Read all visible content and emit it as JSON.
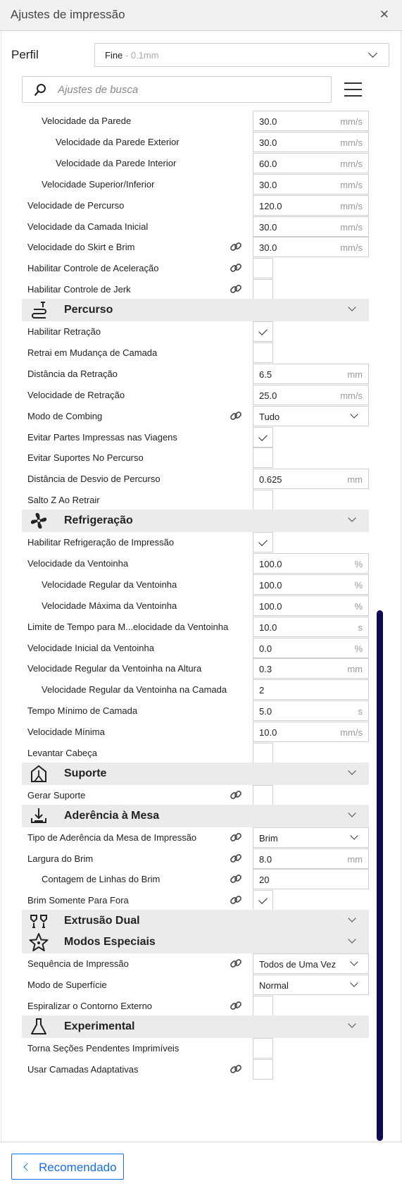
{
  "window": {
    "title": "Ajustes de impressão"
  },
  "profile": {
    "label": "Perfil",
    "name": "Fine",
    "detail": " - 0.1mm"
  },
  "search": {
    "placeholder": "Ajustes de busca"
  },
  "rows": [
    {
      "label": "Velocidade da Parede",
      "indent": 1,
      "control": "field",
      "value": "30.0",
      "unit": "mm/s",
      "link": false
    },
    {
      "label": "Velocidade da Parede Exterior",
      "indent": 2,
      "control": "field",
      "value": "30.0",
      "unit": "mm/s",
      "link": false
    },
    {
      "label": "Velocidade da Parede Interior",
      "indent": 2,
      "control": "field",
      "value": "60.0",
      "unit": "mm/s",
      "link": false
    },
    {
      "label": "Velocidade Superior/Inferior",
      "indent": 1,
      "control": "field",
      "value": "30.0",
      "unit": "mm/s",
      "link": false
    },
    {
      "label": "Velocidade de Percurso",
      "indent": 0,
      "control": "field",
      "value": "120.0",
      "unit": "mm/s",
      "link": false
    },
    {
      "label": "Velocidade da Camada Inicial",
      "indent": 0,
      "control": "field",
      "value": "30.0",
      "unit": "mm/s",
      "link": false
    },
    {
      "label": "Velocidade do Skirt e Brim",
      "indent": 0,
      "control": "field",
      "value": "30.0",
      "unit": "mm/s",
      "link": true
    },
    {
      "label": "Habilitar Controle de Aceleração",
      "indent": 0,
      "control": "checkbox",
      "checked": false,
      "link": true
    },
    {
      "label": "Habilitar Controle de Jerk",
      "indent": 0,
      "control": "checkbox",
      "checked": false,
      "link": true
    },
    {
      "category": "Percurso",
      "icon": "travel-icon"
    },
    {
      "label": "Habilitar Retração",
      "indent": 0,
      "control": "checkbox",
      "checked": true,
      "link": false
    },
    {
      "label": "Retrai em Mudança de Camada",
      "indent": 0,
      "control": "checkbox",
      "checked": false,
      "link": false
    },
    {
      "label": "Distância da Retração",
      "indent": 0,
      "control": "field",
      "value": "6.5",
      "unit": "mm",
      "link": false
    },
    {
      "label": "Velocidade de Retração",
      "indent": 0,
      "control": "field",
      "value": "25.0",
      "unit": "mm/s",
      "link": false
    },
    {
      "label": "Modo de Combing",
      "indent": 0,
      "control": "dropdown",
      "value": "Tudo",
      "link": true
    },
    {
      "label": "Evitar Partes Impressas nas Viagens",
      "indent": 0,
      "control": "checkbox",
      "checked": true,
      "link": false
    },
    {
      "label": "Evitar Suportes No Percurso",
      "indent": 0,
      "control": "checkbox",
      "checked": false,
      "link": false
    },
    {
      "label": "Distância de Desvio de Percurso",
      "indent": 0,
      "control": "field",
      "value": "0.625",
      "unit": "mm",
      "link": false
    },
    {
      "label": "Salto Z Ao Retrair",
      "indent": 0,
      "control": "checkbox",
      "checked": false,
      "link": false
    },
    {
      "category": "Refrigeração",
      "icon": "fan-icon"
    },
    {
      "label": "Habilitar Refrigeração de Impressão",
      "indent": 0,
      "control": "checkbox",
      "checked": true,
      "link": false
    },
    {
      "label": "Velocidade da Ventoinha",
      "indent": 0,
      "control": "field",
      "value": "100.0",
      "unit": "%",
      "link": false
    },
    {
      "label": "Velocidade Regular da Ventoinha",
      "indent": 1,
      "control": "field",
      "value": "100.0",
      "unit": "%",
      "link": false
    },
    {
      "label": "Velocidade Máxima da Ventoinha",
      "indent": 1,
      "control": "field",
      "value": "100.0",
      "unit": "%",
      "link": false
    },
    {
      "label": "Limite de Tempo para M...elocidade da Ventoinha",
      "indent": 0,
      "control": "field",
      "value": "10.0",
      "unit": "s",
      "link": false
    },
    {
      "label": "Velocidade Inicial da Ventoinha",
      "indent": 0,
      "control": "field",
      "value": "0.0",
      "unit": "%",
      "link": false
    },
    {
      "label": "Velocidade Regular da Ventoinha na Altura",
      "indent": 0,
      "control": "field",
      "value": "0.3",
      "unit": "mm",
      "link": false
    },
    {
      "label": "Velocidade Regular da Ventoinha na Camada",
      "indent": 1,
      "control": "field",
      "value": "2",
      "unit": "",
      "link": false
    },
    {
      "label": "Tempo Mínimo de Camada",
      "indent": 0,
      "control": "field",
      "value": "5.0",
      "unit": "s",
      "link": false
    },
    {
      "label": "Velocidade Mínima",
      "indent": 0,
      "control": "field",
      "value": "10.0",
      "unit": "mm/s",
      "link": false
    },
    {
      "label": "Levantar Cabeça",
      "indent": 0,
      "control": "checkbox",
      "checked": false,
      "link": false
    },
    {
      "category": "Suporte",
      "icon": "support-icon"
    },
    {
      "label": "Gerar Suporte",
      "indent": 0,
      "control": "checkbox",
      "checked": false,
      "link": true
    },
    {
      "category": "Aderência à Mesa",
      "icon": "adhesion-icon"
    },
    {
      "label": "Tipo de Aderência da Mesa de Impressão",
      "indent": 0,
      "control": "dropdown",
      "value": "Brim",
      "link": true
    },
    {
      "label": "Largura do Brim",
      "indent": 0,
      "control": "field",
      "value": "8.0",
      "unit": "mm",
      "link": true
    },
    {
      "label": "Contagem de Linhas do Brim",
      "indent": 1,
      "control": "field",
      "value": "20",
      "unit": "",
      "link": true
    },
    {
      "label": "Brim Somente Para Fora",
      "indent": 0,
      "control": "checkbox",
      "checked": true,
      "link": true
    },
    {
      "category": "Extrusão Dual",
      "icon": "dual-extrusion-icon"
    },
    {
      "category": "Modos Especiais",
      "icon": "star-icon"
    },
    {
      "label": "Sequência de Impressão",
      "indent": 0,
      "control": "dropdown",
      "value": "Todos de Uma Vez",
      "link": true
    },
    {
      "label": "Modo de Superfície",
      "indent": 0,
      "control": "dropdown",
      "value": "Normal",
      "link": false
    },
    {
      "label": "Espiralizar o Contorno Externo",
      "indent": 0,
      "control": "checkbox",
      "checked": false,
      "link": true
    },
    {
      "category": "Experimental",
      "icon": "flask-icon"
    },
    {
      "label": "Torna Seções Pendentes Imprimíveis",
      "indent": 0,
      "control": "checkbox",
      "checked": false,
      "link": false
    },
    {
      "label": "Usar Camadas Adaptativas",
      "indent": 0,
      "control": "checkbox",
      "checked": false,
      "link": true
    }
  ],
  "footer": {
    "recommended_label": "Recomendado"
  },
  "colors": {
    "accent": "#196ef0",
    "scrollbar": "#0f0a55",
    "category_bg": "#ebebeb"
  }
}
